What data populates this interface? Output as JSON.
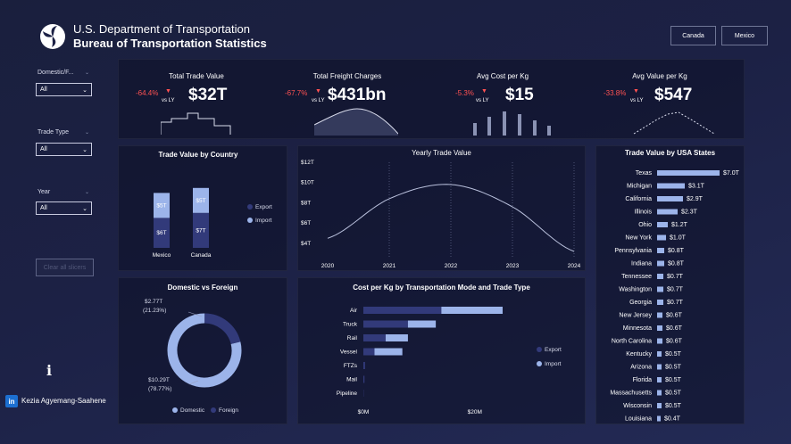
{
  "header": {
    "org_line1": "U.S. Department of Transportation",
    "org_line2": "Bureau of Transportation Statistics",
    "nav_buttons": [
      "Canada",
      "Mexico"
    ]
  },
  "slicers": [
    {
      "label": "Domestic/F...",
      "value": "All"
    },
    {
      "label": "Trade Type",
      "value": "All"
    },
    {
      "label": "Year",
      "value": "All"
    }
  ],
  "clear_button": "Clear all slicers",
  "footer": {
    "info_icon": "i",
    "linkedin_icon": "in",
    "author": "Kezia Agyemang-Saahene"
  },
  "colors": {
    "dark_series": "#323a7a",
    "light_series": "#9cb4ea",
    "negative": "#ff5252"
  },
  "kpis": [
    {
      "title": "Total Trade Value",
      "delta": "-64.4%",
      "vs": "vs LY",
      "value": "$32T",
      "spark": "step"
    },
    {
      "title": "Total Freight Charges",
      "delta": "-67.7%",
      "vs": "vs LY",
      "value": "$431bn",
      "spark": "area"
    },
    {
      "title": "Avg Cost per Kg",
      "delta": "-5.3%",
      "vs": "vs LY",
      "value": "$15",
      "spark": "bars"
    },
    {
      "title": "Avg Value per Kg",
      "delta": "-33.8%",
      "vs": "vs LY",
      "value": "$547",
      "spark": "dashed"
    }
  ],
  "chart_data": [
    {
      "type": "bar",
      "title": "Trade Value by Country",
      "categories": [
        "Mexico",
        "Canada"
      ],
      "series": [
        {
          "name": "Export",
          "values": [
            6,
            7
          ],
          "labels": [
            "$6T",
            "$7T"
          ]
        },
        {
          "name": "Import",
          "values": [
            5,
            5
          ],
          "labels": [
            "$5T",
            "$5T"
          ]
        }
      ],
      "legend": "right"
    },
    {
      "type": "line",
      "title": "Yearly Trade Value",
      "x": [
        2020,
        2021,
        2022,
        2023,
        2024
      ],
      "y": [
        4.5,
        8.4,
        9.8,
        7.6,
        3.2
      ],
      "yticks": [
        "$4T",
        "$6T",
        "$8T",
        "$10T",
        "$12T"
      ],
      "ylim": [
        2.5,
        12
      ],
      "grid": "vertical dotted"
    },
    {
      "type": "pie",
      "title": "Domestic vs Foreign",
      "slices": [
        {
          "name": "Domestic",
          "value": 78.77,
          "label": "$10.29T",
          "pct": "(78.77%)"
        },
        {
          "name": "Foreign",
          "value": 21.23,
          "label": "$2.77T",
          "pct": "(21.23%)"
        }
      ],
      "legend": "bottom"
    },
    {
      "type": "bar",
      "title": "Cost per Kg by Transportation Mode and Trade Type",
      "categories": [
        "Air",
        "Truck",
        "Rail",
        "Vessel",
        "FTZs",
        "Mail",
        "Pipeline"
      ],
      "series": [
        {
          "name": "Export",
          "values": [
            14,
            8,
            4,
            2,
            0.3,
            0.2,
            0.05
          ]
        },
        {
          "name": "Import",
          "values": [
            25,
            13,
            8,
            7,
            0.3,
            0.2,
            0.05
          ]
        }
      ],
      "xticks": [
        "$0M",
        "$20M"
      ],
      "xlim": [
        0,
        25
      ],
      "legend": "right"
    },
    {
      "type": "bar",
      "title": "Trade Value by USA States",
      "categories": [
        "Texas",
        "Michigan",
        "California",
        "Illinois",
        "Ohio",
        "New York",
        "Pennsylvania",
        "Indiana",
        "Tennessee",
        "Washington",
        "Georgia",
        "New Jersey",
        "Minnesota",
        "North Carolina",
        "Kentucky",
        "Arizona",
        "Florida",
        "Massachusetts",
        "Wisconsin",
        "Louisiana"
      ],
      "values": [
        7.0,
        3.1,
        2.9,
        2.3,
        1.2,
        1.0,
        0.8,
        0.8,
        0.7,
        0.7,
        0.7,
        0.6,
        0.6,
        0.6,
        0.5,
        0.5,
        0.5,
        0.5,
        0.5,
        0.4
      ],
      "labels": [
        "$7.0T",
        "$3.1T",
        "$2.9T",
        "$2.3T",
        "$1.2T",
        "$1.0T",
        "$0.8T",
        "$0.8T",
        "$0.7T",
        "$0.7T",
        "$0.7T",
        "$0.6T",
        "$0.6T",
        "$0.6T",
        "$0.5T",
        "$0.5T",
        "$0.5T",
        "$0.5T",
        "$0.5T",
        "$0.4T"
      ]
    }
  ]
}
